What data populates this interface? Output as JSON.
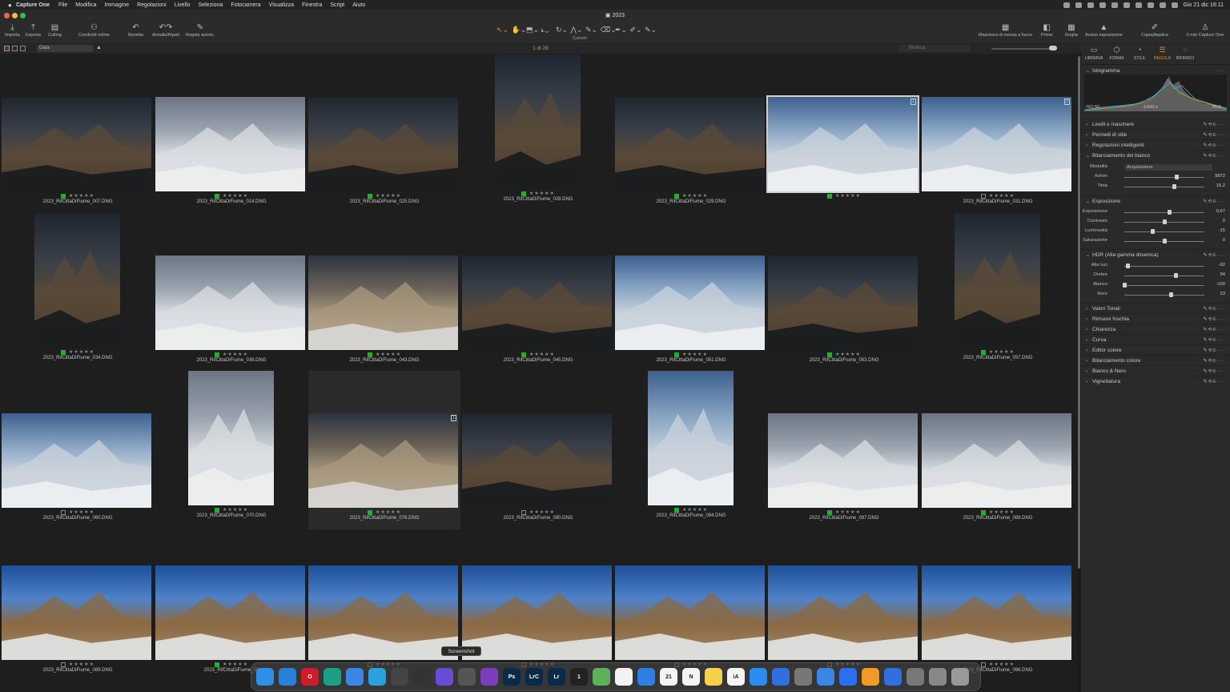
{
  "menubar": {
    "app": "Capture One",
    "items": [
      "File",
      "Modifica",
      "Immagine",
      "Regolazioni",
      "Livello",
      "Seleziona",
      "Fotocamera",
      "Visualizza",
      "Finestra",
      "Script",
      "Aiuto"
    ],
    "datetime": "Gio 21 dic  16:11"
  },
  "window": {
    "title": "2023"
  },
  "toolbar": {
    "left": [
      {
        "label": "Importa",
        "icon": "import-icon"
      },
      {
        "label": "Esporta",
        "icon": "export-icon"
      },
      {
        "label": "Culling",
        "icon": "culling-icon"
      },
      {
        "label": "Condividi online",
        "icon": "share-icon"
      },
      {
        "label": "Resetta",
        "icon": "reset-icon"
      },
      {
        "label": "Annulla/Ripeti",
        "icon": "undo-redo-icon"
      },
      {
        "label": "Regola autom.",
        "icon": "auto-adjust-icon"
      }
    ],
    "cursors_label": "Cursori",
    "cursor_tools": [
      "select-cursor-icon",
      "pan-cursor-icon",
      "crop-overlay-icon",
      "crop-icon",
      "rotate-icon",
      "keystone-icon",
      "brush-icon",
      "eraser-icon",
      "picker-icon",
      "annotate-icon",
      "spot-icon"
    ],
    "right": [
      {
        "label": "Maschera di messa a fuoco",
        "icon": "focus-mask-icon"
      },
      {
        "label": "Prima",
        "icon": "before-icon"
      },
      {
        "label": "Griglia",
        "icon": "grid-icon"
      },
      {
        "label": "Avviso esposizione",
        "icon": "exposure-warning-icon"
      },
      {
        "label": "Copia|Applica",
        "icon": "copy-apply-icon"
      },
      {
        "label": "Il mio Capture One",
        "icon": "account-icon"
      }
    ]
  },
  "browser": {
    "sort": "Data",
    "counter": "1 di 29",
    "search_placeholder": "Ricerca",
    "stars": "★★★★★",
    "items": [
      {
        "name": "2023_RifCittaDiFiume_007.DNG",
        "label": "green",
        "orient": "land",
        "theme": "dark"
      },
      {
        "name": "2023_RifCittaDiFiume_014.DNG",
        "label": "green",
        "orient": "land",
        "theme": "snow"
      },
      {
        "name": "2023_RifCittaDiFiume_025.DNG",
        "label": "green",
        "orient": "land",
        "theme": "dark"
      },
      {
        "name": "2023_RifCittaDiFiume_028.DNG",
        "label": "green",
        "orient": "port",
        "theme": "dark"
      },
      {
        "name": "2023_RifCittaDiFiume_029.DNG",
        "label": "green",
        "orient": "land",
        "theme": "dark"
      },
      {
        "name": "",
        "label": "green",
        "orient": "land",
        "theme": "snowsky",
        "current": true,
        "badge": "1"
      },
      {
        "name": "2023_RifCittaDiFiume_031.DNG",
        "label": "none",
        "orient": "land",
        "theme": "snowsky",
        "badge": "2"
      },
      {
        "name": "2023_RifCittaDiFiume_034.DNG",
        "label": "green",
        "orient": "port",
        "theme": "dark"
      },
      {
        "name": "2023_RifCittaDiFiume_038.DNG",
        "label": "green",
        "orient": "land",
        "theme": "snow"
      },
      {
        "name": "2023_RifCittaDiFiume_043.DNG",
        "label": "green",
        "orient": "land",
        "theme": "rock"
      },
      {
        "name": "2023_RifCittaDiFiume_045.DNG",
        "label": "green",
        "orient": "land",
        "theme": "dark"
      },
      {
        "name": "2023_RifCittaDiFiume_051.DNG",
        "label": "green",
        "orient": "land",
        "theme": "snowsky"
      },
      {
        "name": "2023_RifCittaDiFiume_053.DNG",
        "label": "green",
        "orient": "land",
        "theme": "dark"
      },
      {
        "name": "2023_RifCittaDiFiume_057.DNG",
        "label": "green",
        "orient": "port",
        "theme": "dark"
      },
      {
        "name": "2023_RifCittaDiFiume_060.DNG",
        "label": "none",
        "orient": "land",
        "theme": "snowsky"
      },
      {
        "name": "2023_RifCittaDiFiume_070.DNG",
        "label": "green",
        "orient": "port",
        "theme": "snow"
      },
      {
        "name": "2023_RifCittaDiFiume_076.DNG",
        "label": "green",
        "orient": "land",
        "theme": "rock",
        "badge": "1",
        "selected": true
      },
      {
        "name": "2023_RifCittaDiFiume_080.DNG",
        "label": "none",
        "orient": "land",
        "theme": "dark"
      },
      {
        "name": "2023_RifCittaDiFiume_084.DNG",
        "label": "green",
        "orient": "port",
        "theme": "snowsky"
      },
      {
        "name": "2023_RifCittaDiFiume_087.DNG",
        "label": "green",
        "orient": "land",
        "theme": "snow"
      },
      {
        "name": "2023_RifCittaDiFiume_088.DNG",
        "label": "green",
        "orient": "land",
        "theme": "snow"
      },
      {
        "name": "2023_RifCittaDiFiume_089.DNG",
        "label": "none",
        "orient": "land",
        "theme": "blue"
      },
      {
        "name": "2023_RifCittaDiFiume_09",
        "label": "green",
        "orient": "land",
        "theme": "blue"
      },
      {
        "name": "",
        "label": "none",
        "orient": "land",
        "theme": "blue"
      },
      {
        "name": "",
        "label": "none",
        "orient": "land",
        "theme": "blue"
      },
      {
        "name": "",
        "label": "none",
        "orient": "land",
        "theme": "blue"
      },
      {
        "name": "",
        "label": "none",
        "orient": "land",
        "theme": "blue"
      },
      {
        "name": "2023_RifCittaDiFiume_096.DNG",
        "label": "none",
        "orient": "land",
        "theme": "blue"
      }
    ]
  },
  "panel": {
    "tabs": [
      {
        "label": "LIBRERIA",
        "icon": "library-icon"
      },
      {
        "label": "FORMA",
        "icon": "shape-icon"
      },
      {
        "label": "STILE",
        "icon": "style-icon"
      },
      {
        "label": "REGOLA",
        "icon": "adjust-icon",
        "active": true
      },
      {
        "label": "RIFINISCI",
        "icon": "refine-icon"
      }
    ],
    "histogram": {
      "title": "Istogramma",
      "iso": "ISO 50",
      "shutter": "1/640 s",
      "aperture": "f/5.6"
    },
    "wb": {
      "title": "Bilanciamento del bianco",
      "mode_label": "Modalità",
      "mode": "Acquisizione",
      "sliders": [
        {
          "label": "Kelvin",
          "value": "9872",
          "pos": 0.65
        },
        {
          "label": "Tinta",
          "value": "15,2",
          "pos": 0.62
        }
      ]
    },
    "exposure": {
      "title": "Esposizione",
      "sliders": [
        {
          "label": "Esposizione",
          "value": "0,67",
          "pos": 0.56
        },
        {
          "label": "Contrasto",
          "value": "0",
          "pos": 0.5
        },
        {
          "label": "Luminosità",
          "value": "-15",
          "pos": 0.35
        },
        {
          "label": "Saturazione",
          "value": "0",
          "pos": 0.5
        }
      ]
    },
    "hdr": {
      "title": "HDR (Alta gamma dinamica)",
      "sliders": [
        {
          "label": "Alte luci",
          "value": "-92",
          "pos": 0.04
        },
        {
          "label": "Ombre",
          "value": "34",
          "pos": 0.64
        },
        {
          "label": "Bianco",
          "value": "-100",
          "pos": 0.0
        },
        {
          "label": "Nero",
          "value": "23",
          "pos": 0.58
        }
      ]
    },
    "sections_top": [
      "Livelli e maschere",
      "Pennelli di stile",
      "Regolazioni intelligenti"
    ],
    "sections_bottom": [
      "Valori Tonali",
      "Rimuovi foschia",
      "Chiarezza",
      "Curva",
      "Editor colore",
      "Bilanciamento colore",
      "Bianco & Nero",
      "Vignettatura"
    ]
  },
  "dock": {
    "tooltip": "Screenshot",
    "date_icon": "21",
    "apps": [
      {
        "name": "finder",
        "color": "#2f8ee8",
        "t": ""
      },
      {
        "name": "safari",
        "color": "#2a7fd8",
        "t": ""
      },
      {
        "name": "opera",
        "color": "#d31a2a",
        "t": "O"
      },
      {
        "name": "edge",
        "color": "#1aa087",
        "t": ""
      },
      {
        "name": "mail",
        "color": "#3a86e6",
        "t": ""
      },
      {
        "name": "telegram",
        "color": "#2aa1da",
        "t": ""
      },
      {
        "name": "clapper",
        "color": "#444",
        "t": ""
      },
      {
        "name": "resolve",
        "color": "#333",
        "t": ""
      },
      {
        "name": "affinity",
        "color": "#6a4bd6",
        "t": ""
      },
      {
        "name": "screenshot",
        "color": "#555",
        "t": ""
      },
      {
        "name": "affinity-photo",
        "color": "#7b3fbe",
        "t": ""
      },
      {
        "name": "photoshop",
        "color": "#0b2a4a",
        "t": "Ps"
      },
      {
        "name": "lightroom-classic",
        "color": "#0b2a4a",
        "t": "LrC"
      },
      {
        "name": "lightroom",
        "color": "#0b2a4a",
        "t": "Lr"
      },
      {
        "name": "capture-one",
        "color": "#222",
        "t": "1"
      },
      {
        "name": "maps",
        "color": "#5bb25b",
        "t": ""
      },
      {
        "name": "reminders",
        "color": "#f2f2f2",
        "t": ""
      },
      {
        "name": "things",
        "color": "#2f7ee6",
        "t": ""
      },
      {
        "name": "calendar",
        "color": "#f4f4f4",
        "t": "21"
      },
      {
        "name": "notion",
        "color": "#f4f4f4",
        "t": "N"
      },
      {
        "name": "notes",
        "color": "#f5d24a",
        "t": ""
      },
      {
        "name": "ia-writer",
        "color": "#f4f4f4",
        "t": "iA"
      },
      {
        "name": "app-store",
        "color": "#2a8cf0",
        "t": ""
      },
      {
        "name": "1password",
        "color": "#2f6fe0",
        "t": ""
      },
      {
        "name": "settings",
        "color": "#777",
        "t": ""
      },
      {
        "name": "airdrop",
        "color": "#3a86e6",
        "t": ""
      },
      {
        "name": "dropbox",
        "color": "#2a6ff0",
        "t": ""
      },
      {
        "name": "home",
        "color": "#f39a25",
        "t": ""
      },
      {
        "name": "1password-2",
        "color": "#2f6fe0",
        "t": ""
      },
      {
        "name": "folder-1",
        "color": "#777",
        "t": ""
      },
      {
        "name": "folder-2",
        "color": "#888",
        "t": ""
      },
      {
        "name": "trash",
        "color": "#999",
        "t": ""
      }
    ]
  },
  "colors": {
    "accent": "#e8912a",
    "label_green": "#22b02c"
  }
}
